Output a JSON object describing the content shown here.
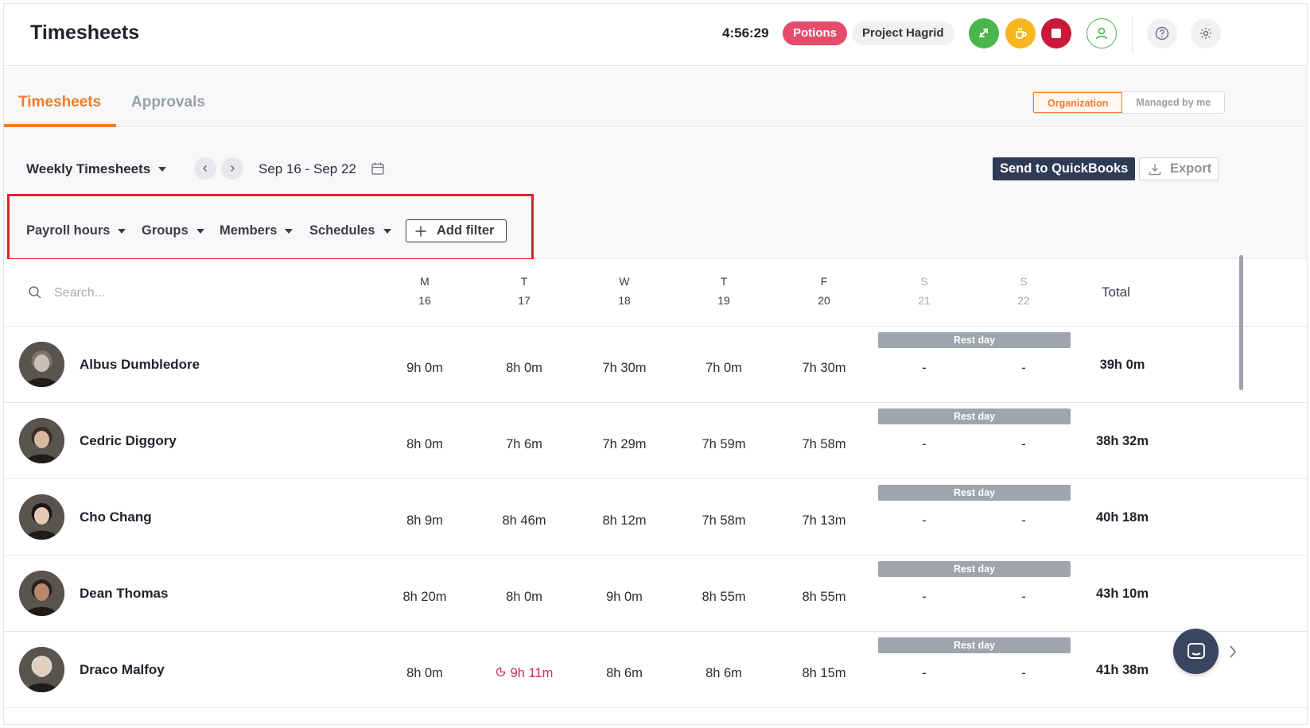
{
  "header": {
    "title": "Timesheets",
    "timer": "4:56:29",
    "task_badge": "Potions",
    "project_badge": "Project Hagrid"
  },
  "tabs": {
    "active": "Timesheets",
    "inactive": "Approvals",
    "scope_options": [
      "Organization",
      "Managed by me"
    ]
  },
  "toolbar": {
    "view": "Weekly Timesheets",
    "date_range": "Sep 16 - Sep 22",
    "send_button": "Send to QuickBooks",
    "export_button": "Export"
  },
  "filters": {
    "items": [
      "Payroll hours",
      "Groups",
      "Members",
      "Schedules"
    ],
    "add_filter": "Add filter"
  },
  "search": {
    "placeholder": "Search..."
  },
  "days": [
    {
      "letter": "M",
      "num": "16"
    },
    {
      "letter": "T",
      "num": "17"
    },
    {
      "letter": "W",
      "num": "18"
    },
    {
      "letter": "T",
      "num": "19"
    },
    {
      "letter": "F",
      "num": "20"
    },
    {
      "letter": "S",
      "num": "21"
    },
    {
      "letter": "S",
      "num": "22"
    }
  ],
  "total_label": "Total",
  "rest_day_label": "Rest day",
  "members": [
    {
      "name": "Albus Dumbledore",
      "hours": [
        "9h 0m",
        "8h 0m",
        "7h 30m",
        "7h 0m",
        "7h 30m",
        "-",
        "-"
      ],
      "total": "39h 0m"
    },
    {
      "name": "Cedric Diggory",
      "hours": [
        "8h 0m",
        "7h 6m",
        "7h 29m",
        "7h 59m",
        "7h 58m",
        "-",
        "-"
      ],
      "total": "38h 32m"
    },
    {
      "name": "Cho Chang",
      "hours": [
        "8h 9m",
        "8h 46m",
        "8h 12m",
        "7h 58m",
        "7h 13m",
        "-",
        "-"
      ],
      "total": "40h 18m"
    },
    {
      "name": "Dean Thomas",
      "hours": [
        "8h 20m",
        "8h 0m",
        "9h 0m",
        "8h 55m",
        "8h 55m",
        "-",
        "-"
      ],
      "total": "43h 10m"
    },
    {
      "name": "Draco Malfoy",
      "hours": [
        "8h 0m",
        "9h 11m",
        "8h 6m",
        "8h 6m",
        "8h 15m",
        "-",
        "-"
      ],
      "total": "41h 38m"
    }
  ],
  "colors": {
    "accent": "#f27c2c",
    "overtime": "#d42a55",
    "highlight": "#e0202a",
    "primary_button": "#2f3b56"
  }
}
